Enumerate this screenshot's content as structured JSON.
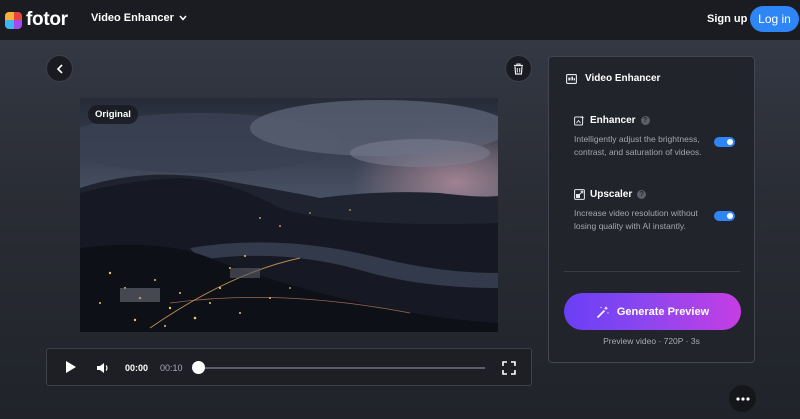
{
  "app": {
    "logo_text": "fotor",
    "nav_menu_label": "Video Enhancer",
    "signup_label": "Sign up",
    "login_label": "Log in",
    "accent": "#2e86f6"
  },
  "video": {
    "badge": "Original"
  },
  "player": {
    "current_time": "00:00",
    "duration": "00:10",
    "progress": 0
  },
  "panel": {
    "title": "Video Enhancer",
    "features": [
      {
        "name": "Enhancer",
        "description": "Intelligently adjust the brightness, contrast, and saturation of videos.",
        "enabled": true
      },
      {
        "name": "Upscaler",
        "description": "Increase video resolution without losing quality with AI instantly.",
        "enabled": true
      }
    ],
    "generate_label": "Generate Preview",
    "preview_info": "Preview video · 720P · 3s"
  },
  "icons": {
    "back": "chevron-left-icon",
    "trash": "trash-icon",
    "more": "more-horizontal-icon",
    "play": "play-icon",
    "volume": "volume-icon",
    "fullscreen": "fullscreen-icon",
    "magic": "magic-wand-icon"
  }
}
